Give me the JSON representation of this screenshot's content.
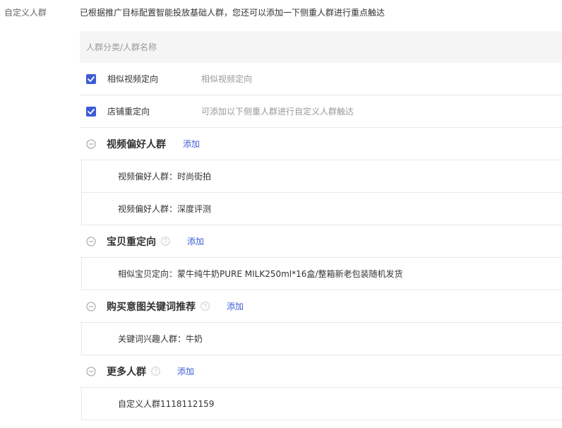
{
  "field_label": "自定义人群",
  "intro_text": "已根据推广目标配置智能投放基础人群，您还可以添加一下侧重人群进行重点触达",
  "search": {
    "placeholder": "人群分类/人群名称"
  },
  "checked_rows": [
    {
      "label": "相似视频定向",
      "description": "相似视频定向",
      "checked": true
    },
    {
      "label": "店铺重定向",
      "description": "可添加以下侧重人群进行自定义人群触达",
      "checked": true
    }
  ],
  "groups": [
    {
      "title": "视频偏好人群",
      "has_help": false,
      "add_label": "添加",
      "items": [
        "视频偏好人群：时尚街拍",
        "视频偏好人群：深度评测"
      ]
    },
    {
      "title": "宝贝重定向",
      "has_help": true,
      "add_label": "添加",
      "items": [
        "相似宝贝定向：蒙牛纯牛奶PURE MILK250ml*16盒/整箱新老包装随机发货"
      ]
    },
    {
      "title": "购买意图关键词推荐",
      "has_help": true,
      "add_label": "添加",
      "items": [
        "关键词兴趣人群：牛奶"
      ]
    },
    {
      "title": "更多人群",
      "has_help": true,
      "add_label": "添加",
      "items": [
        "自定义人群1118112159"
      ]
    }
  ],
  "colors": {
    "accent": "#3d5bd7",
    "text": "#333333",
    "muted": "#999999",
    "divider": "#e8e8e8",
    "search_bg": "#f5f5f5"
  },
  "icons": {
    "checkbox": "checkbox-checked-icon",
    "collapse": "minus-circle-icon",
    "help": "question-circle-icon"
  }
}
